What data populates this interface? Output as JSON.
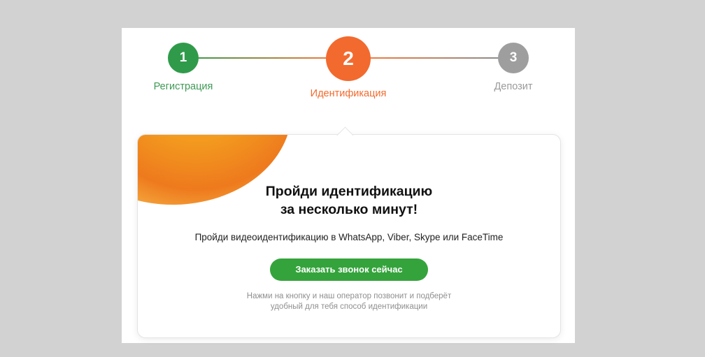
{
  "stepper": {
    "steps": [
      {
        "number": "1",
        "label": "Регистрация",
        "state": "done",
        "color": "#2f9b4a"
      },
      {
        "number": "2",
        "label": "Идентификация",
        "state": "active",
        "color": "#f26a2e"
      },
      {
        "number": "3",
        "label": "Депозит",
        "state": "pending",
        "color": "#9e9e9e"
      }
    ]
  },
  "card": {
    "heading_line1": "Пройди идентификацию",
    "heading_line2": "за несколько минут!",
    "subtext": "Пройди видеоидентификацию в WhatsApp, Viber, Skype или FaceTime",
    "cta_label": "Заказать звонок сейчас",
    "hint_line1": "Нажми на кнопку и наш оператор позвонит и подберёт",
    "hint_line2": "удобный для тебя способ идентификации"
  },
  "colors": {
    "background": "#d2d2d2",
    "cta": "#35a33c",
    "accent_orange": "#f26a2e"
  }
}
